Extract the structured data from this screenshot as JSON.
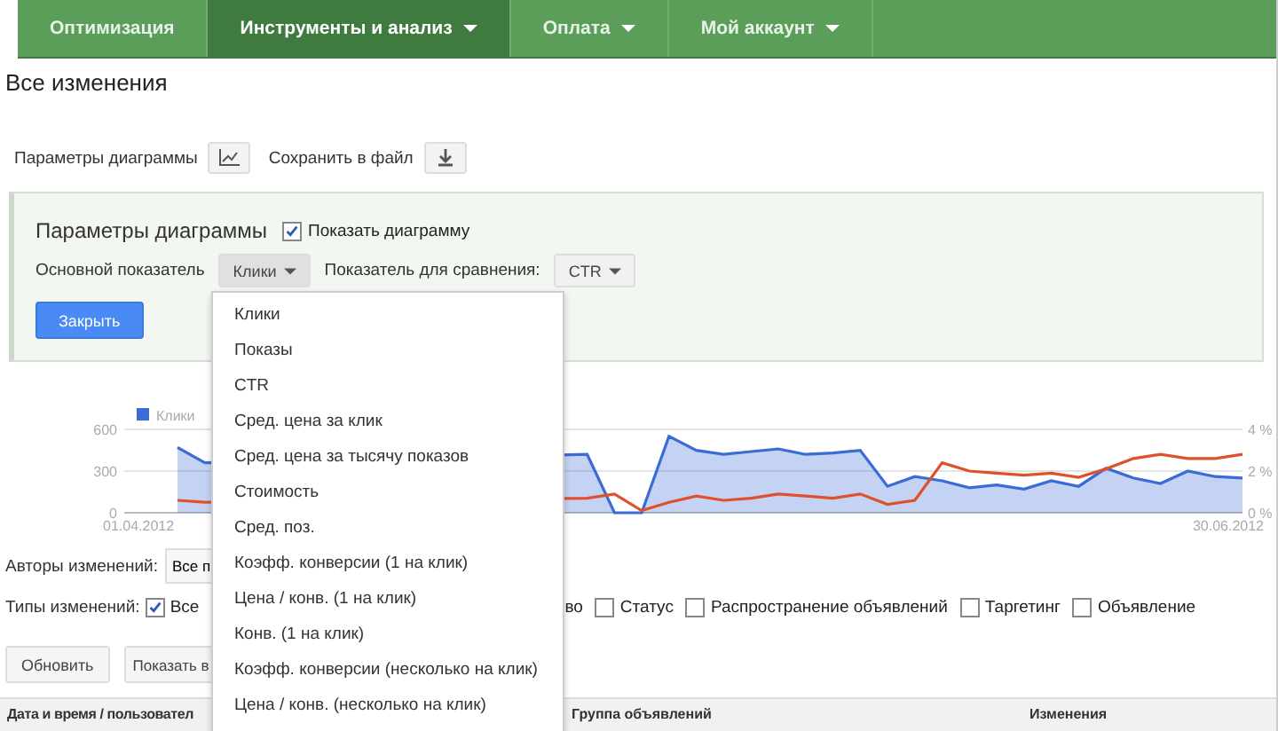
{
  "nav": {
    "tabs": [
      {
        "label": "Оптимизация",
        "selected": false,
        "has_menu": false
      },
      {
        "label": "Инструменты и анализ",
        "selected": true,
        "has_menu": true
      },
      {
        "label": "Оплата",
        "selected": false,
        "has_menu": true
      },
      {
        "label": "Мой аккаунт",
        "selected": false,
        "has_menu": true
      }
    ]
  },
  "page_title": "Все изменения",
  "toolbar": {
    "chart_settings_label": "Параметры диаграммы",
    "save_label": "Сохранить в файл"
  },
  "chart_panel": {
    "title": "Параметры диаграммы",
    "show_chart": {
      "label": "Показать диаграмму",
      "checked": true
    },
    "main_metric_label": "Основной показатель",
    "main_metric": "Клики",
    "compare_label": "Показатель для сравнения:",
    "compare_metric": "CTR",
    "close_button": "Закрыть"
  },
  "chart": {
    "start_date": "01.04.2012",
    "end_date": "30.06.2012",
    "chart_data": {
      "type": "area",
      "categories": [
        null,
        null,
        null,
        null,
        null,
        null,
        null,
        null,
        null,
        null,
        null,
        null,
        null,
        null,
        null,
        null,
        null,
        null,
        null,
        null,
        null,
        null,
        null,
        null,
        null,
        null,
        null,
        null,
        null,
        null,
        null,
        null,
        null,
        null,
        null,
        null,
        null,
        null,
        null,
        null
      ],
      "ylim": [
        0,
        600
      ],
      "yticks": [
        0,
        300,
        600
      ],
      "series": [
        {
          "name": "Клики",
          "color": "#3a6bd6",
          "values": [
            470,
            360,
            null,
            null,
            null,
            null,
            null,
            null,
            null,
            null,
            null,
            null,
            null,
            null,
            null,
            420,
            0,
            0,
            550,
            450,
            420,
            440,
            460,
            420,
            430,
            450,
            190,
            260,
            230,
            180,
            200,
            170,
            230,
            190,
            320,
            250,
            210,
            300,
            260,
            250
          ]
        }
      ]
    }
  },
  "compare_chart": {
    "chart_data": {
      "type": "line",
      "categories": [
        null,
        null,
        null,
        null,
        null,
        null,
        null,
        null,
        null,
        null,
        null,
        null,
        null,
        null,
        null,
        null,
        null,
        null,
        null,
        null,
        null,
        null,
        null,
        null,
        null,
        null,
        null,
        null,
        null,
        null,
        null,
        null,
        null,
        null,
        null,
        null,
        null,
        null,
        null,
        null
      ],
      "ylim": [
        0,
        4
      ],
      "yticks": [
        {
          "value": 0,
          "label": "0 %"
        },
        {
          "value": 2,
          "label": "2 %"
        },
        {
          "value": 4,
          "label": "4 %"
        }
      ],
      "series": [
        {
          "color": "#e0502b",
          "values": [
            0.6,
            0.5,
            null,
            null,
            null,
            null,
            null,
            null,
            null,
            null,
            null,
            null,
            null,
            null,
            null,
            0.7,
            0.9,
            0.1,
            0.5,
            0.8,
            0.6,
            0.7,
            0.9,
            0.8,
            0.7,
            0.9,
            0.4,
            0.6,
            2.4,
            2.0,
            1.9,
            1.8,
            1.9,
            1.7,
            2.1,
            2.6,
            2.8,
            2.6,
            2.6,
            2.8
          ]
        }
      ]
    }
  },
  "filters": {
    "authors_label": "Авторы изменений:",
    "authors_value": "Все п",
    "types_label": "Типы изменений:",
    "types": [
      {
        "kind": "checkbox",
        "label": "Все",
        "checked": true
      },
      {
        "kind": "fragment",
        "label": "во"
      },
      {
        "kind": "checkbox",
        "label": "Статус",
        "checked": false
      },
      {
        "kind": "checkbox",
        "label": "Распространение объявлений",
        "checked": false
      },
      {
        "kind": "checkbox",
        "label": "Таргетинг",
        "checked": false
      },
      {
        "kind": "checkbox",
        "label": "Объявление",
        "checked": false
      }
    ]
  },
  "actions": [
    "Обновить",
    "Показать в"
  ],
  "table": {
    "columns": [
      "Дата и время / пользовател",
      "Группа объявлений",
      "Изменения"
    ]
  },
  "metric_menu": {
    "items": [
      "Клики",
      "Показы",
      "CTR",
      "Сред. цена за клик",
      "Сред. цена за тысячу показов",
      "Стоимость",
      "Сред. поз.",
      "Коэфф. конверсии (1 на клик)",
      "Цена / конв. (1 на клик)",
      "Конв. (1 на клик)",
      "Коэфф. конверсии (несколько на клик)",
      "Цена / конв. (несколько на клик)"
    ]
  }
}
